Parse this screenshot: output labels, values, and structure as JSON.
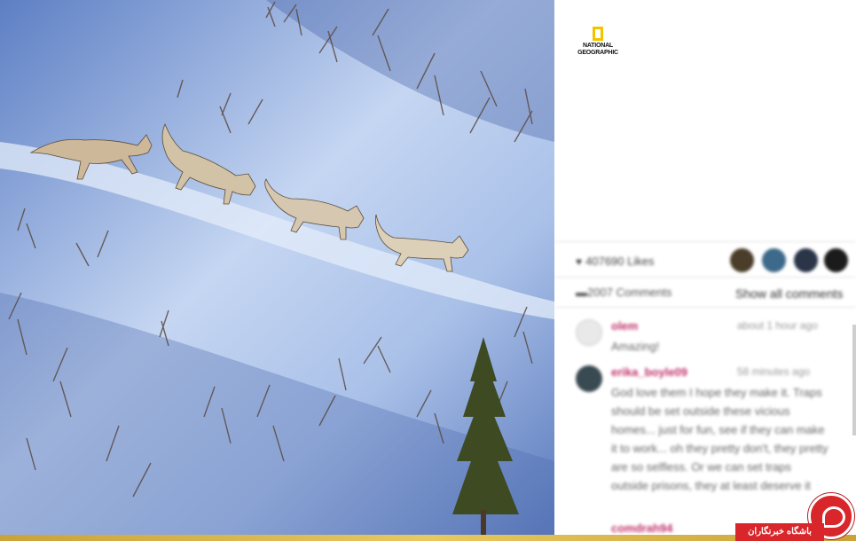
{
  "brand": {
    "name": "NATIONAL GEOGRAPHIC",
    "line1": "NATIONAL",
    "line2": "GEOGRAPHIC",
    "accent_color": "#f3c300"
  },
  "post": {
    "photo_subject": "four grey wolves walking in a line across snowy slope",
    "likes": "407690 Likes",
    "comments_count": "2007 Comments",
    "show_all": "Show all comments",
    "avatar_colors": [
      "#4a3d2a",
      "#3d6a8a",
      "#2a3548",
      "#1b1b1b"
    ]
  },
  "comments": [
    {
      "username": "olem",
      "time": "about 1 hour ago",
      "text": "Amazing!"
    },
    {
      "username": "erika_boyle09",
      "time": "58 minutes ago",
      "text": "God love them I hope they make it. Traps should be set outside these vicious homes... just for fun, see if they can make it to work... oh they pretty don't, they pretty are so selfless. Or we can set traps outside prisons, they at least deserve it"
    },
    {
      "username": "comdrah94",
      "time": "",
      "text": ""
    }
  ],
  "watermark": {
    "text": "باشگاه خبرنگاران",
    "color": "#d8262b"
  }
}
